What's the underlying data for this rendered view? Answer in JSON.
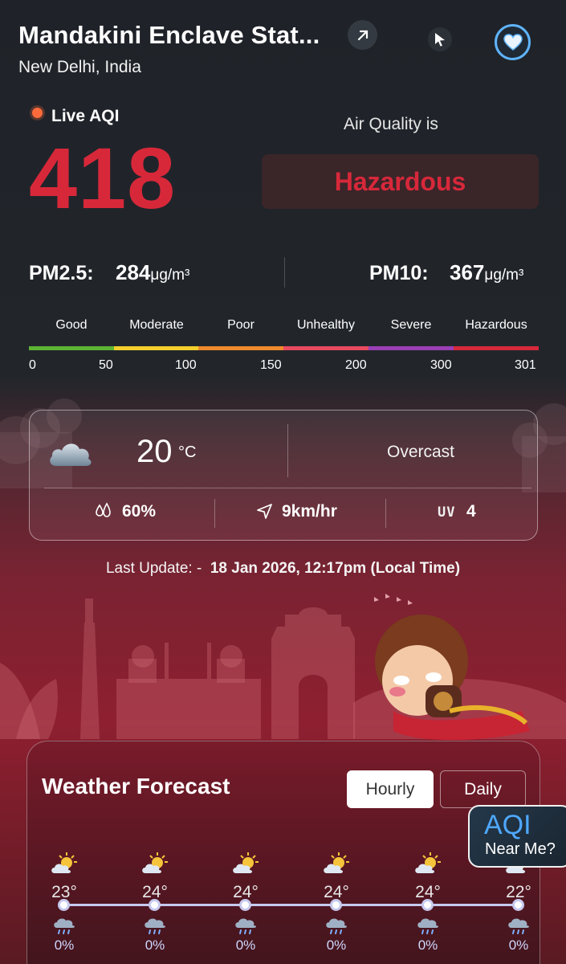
{
  "header": {
    "station_name": "Mandakini Enclave Stat...",
    "location": "New Delhi, India"
  },
  "aqi": {
    "live_label": "Live AQI",
    "value": "418",
    "air_quality_is_label": "Air Quality is",
    "status": "Hazardous",
    "status_color": "#d7283a"
  },
  "pollutants": {
    "pm25_label": "PM2.5:",
    "pm25_value": "284",
    "pm10_label": "PM10:",
    "pm10_value": "367",
    "unit": "μg/m³"
  },
  "scale": {
    "categories": [
      "Good",
      "Moderate",
      "Poor",
      "Unhealthy",
      "Severe",
      "Hazardous"
    ],
    "colors": [
      "#5db434",
      "#f4cf2c",
      "#f08a2c",
      "#e84a5f",
      "#9a3fb5",
      "#d7283a"
    ],
    "ticks": [
      "0",
      "50",
      "100",
      "150",
      "200",
      "300",
      "301"
    ]
  },
  "weather": {
    "icon": "overcast-cloud-icon",
    "temperature": "20",
    "temperature_unit": "°C",
    "condition": "Overcast",
    "humidity": "60%",
    "wind": "9km/hr",
    "uv_label": "UV",
    "uv": "4"
  },
  "last_update": {
    "label": "Last Update: -",
    "value": "18 Jan 2026, 12:17pm (Local Time)"
  },
  "forecast": {
    "title": "Weather Forecast",
    "tabs": [
      "Hourly",
      "Daily"
    ],
    "selected_tab": "Hourly",
    "hours": [
      {
        "temp": "23°",
        "rain": "0%"
      },
      {
        "temp": "24°",
        "rain": "0%"
      },
      {
        "temp": "24°",
        "rain": "0%"
      },
      {
        "temp": "24°",
        "rain": "0%"
      },
      {
        "temp": "24°",
        "rain": "0%"
      },
      {
        "temp": "22°",
        "rain": "0%"
      }
    ]
  },
  "near_me": {
    "aqi_text": "AQI",
    "label": "Near Me?"
  }
}
